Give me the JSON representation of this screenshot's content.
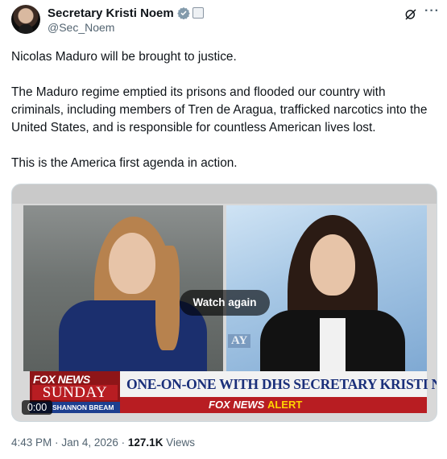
{
  "author": {
    "name": "Secretary Kristi Noem",
    "handle": "@Sec_Noem",
    "avatar_icon": "profile-photo",
    "verified_color": "#829aab"
  },
  "tweet": {
    "paragraphs": [
      "Nicolas Maduro will be brought to justice.",
      "The Maduro regime emptied its prisons and flooded our country with criminals, including members of Tren de Aragua, trafficked narcotics into the United States, and is responsible for countless American lives lost.",
      "This is the America first agenda in action."
    ]
  },
  "video": {
    "watch_again_label": "Watch again",
    "time": "0:00",
    "chyron": {
      "network_logo": "FOX NEWS",
      "show": "SUNDAY",
      "anchor": "SHANNON BREAM",
      "headline": "ONE-ON-ONE WITH DHS SECRETARY KRISTI NOEM",
      "alert_network": "FOX NEWS",
      "alert_word": "ALERT"
    },
    "background_sign": "AY"
  },
  "meta": {
    "time": "4:43 PM",
    "date": "Jan 4, 2026",
    "views_count": "127.1K",
    "views_label": "Views",
    "separator": "·"
  },
  "colors": {
    "text_primary": "#0f1419",
    "text_secondary": "#536471",
    "fox_red": "#b81d22",
    "fox_blue": "#1a2f7a",
    "alert_yellow": "#ffd400"
  }
}
